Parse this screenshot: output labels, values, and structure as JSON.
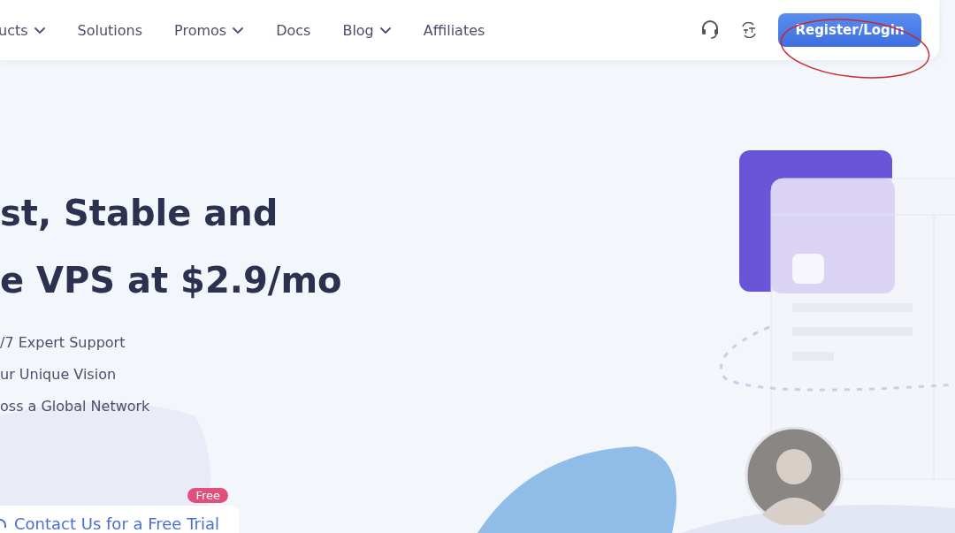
{
  "nav": {
    "items": [
      {
        "label": "ucts",
        "dropdown": true
      },
      {
        "label": "Solutions",
        "dropdown": false
      },
      {
        "label": "Promos",
        "dropdown": true
      },
      {
        "label": "Docs",
        "dropdown": false
      },
      {
        "label": "Blog",
        "dropdown": true
      },
      {
        "label": "Affiliates",
        "dropdown": false
      }
    ],
    "login_button": "Register/Login"
  },
  "hero": {
    "headline": [
      "st, Stable and",
      "e VPS at $2.9/mo"
    ],
    "features": [
      "/7 Expert Support",
      "ur Unique Vision",
      "oss a Global Network"
    ],
    "trial": {
      "badge": "Free",
      "label": "Contact Us for a Free Trial"
    }
  }
}
